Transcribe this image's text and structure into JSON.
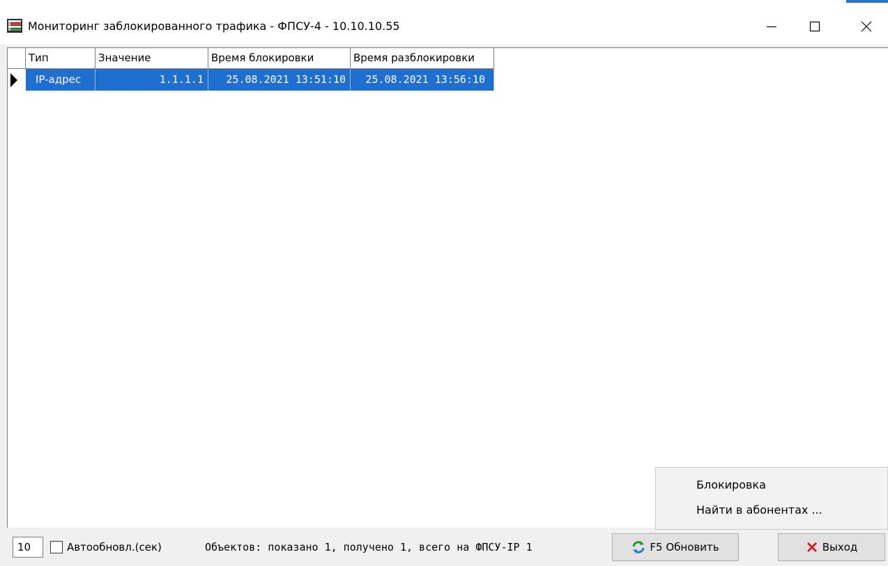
{
  "window": {
    "title": "Мониторинг заблокированного трафика - ФПСУ-4 - 10.10.10.55",
    "controls": [
      "minimize",
      "maximize",
      "close"
    ]
  },
  "table": {
    "columns": [
      "Тип",
      "Значение",
      "Время блокировки",
      "Время разблокировки"
    ],
    "rows": [
      {
        "type": "IP-адрес",
        "value": "1.1.1.1",
        "block_time": "25.08.2021 13:51:10",
        "unblock_time": "25.08.2021 13:56:10",
        "selected": true
      }
    ]
  },
  "context_menu": {
    "items": [
      "Блокировка",
      "Найти в абонентах ..."
    ]
  },
  "statusbar": {
    "interval": "10",
    "autorefresh_label": "Автообновл.(сек)",
    "autorefresh_checked": false,
    "status_text": "Объектов: показано 1,  получено 1,  всего на ФПСУ-IP 1",
    "refresh_label": "F5 Обновить",
    "exit_label": "Выход"
  },
  "colors": {
    "selection": "#1f6fd1",
    "window_bg": "#f0f0f0"
  }
}
